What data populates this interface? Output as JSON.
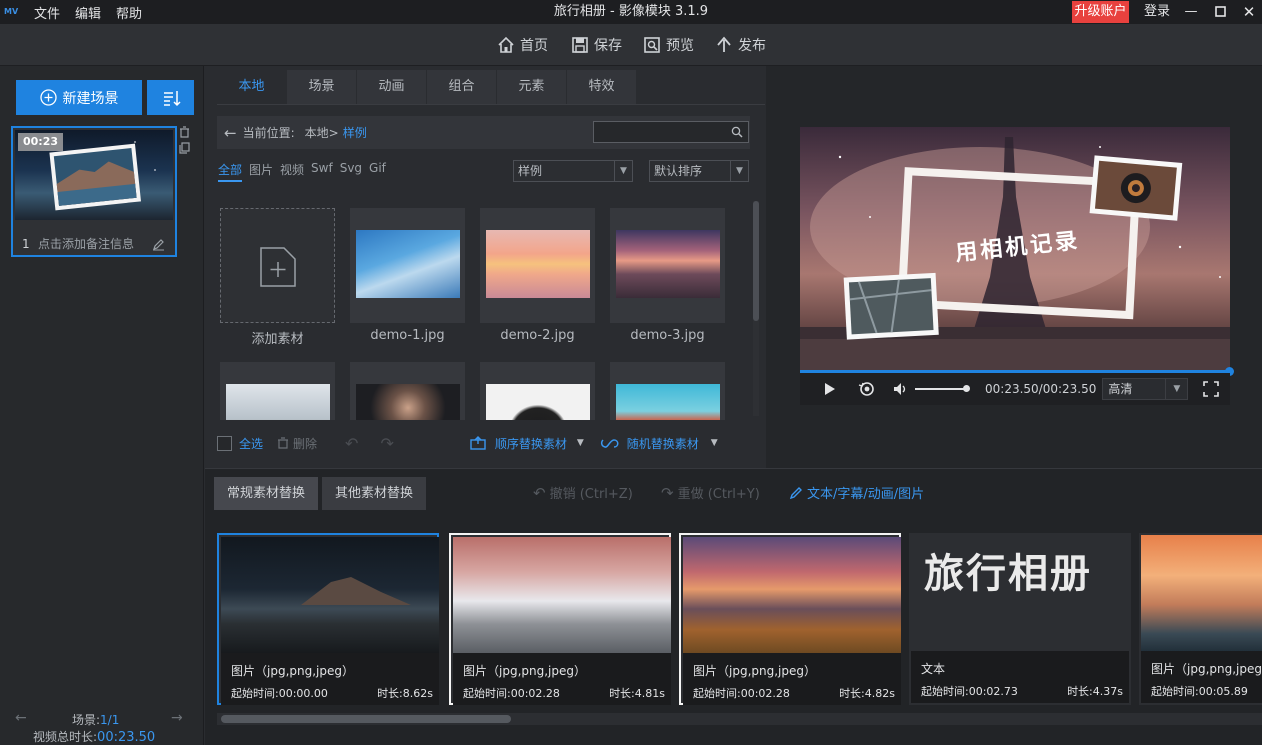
{
  "app": {
    "logo": "MV",
    "title": "旅行相册 - 影像模块 3.1.9"
  },
  "menu": [
    "文件",
    "编辑",
    "帮助"
  ],
  "account": {
    "upgrade": "升级账户",
    "login": "登录"
  },
  "toolbar": {
    "home": "首页",
    "save": "保存",
    "preview": "预览",
    "publish": "发布"
  },
  "scenes": {
    "new_scene": "新建场景",
    "cards": [
      {
        "duration": "00:23",
        "index": "1",
        "note": "点击添加备注信息"
      }
    ],
    "footer": {
      "scene_label": "场景:",
      "scene_value": "1/1",
      "total_label": "视频总时长:",
      "total_value": "00:23.50"
    }
  },
  "library": {
    "tabs": [
      "本地",
      "场景",
      "动画",
      "组合",
      "元素",
      "特效"
    ],
    "location_label": "当前位置:",
    "location_root": "本地>",
    "location_current": "样例",
    "search_placeholder": "",
    "filters": [
      "全部",
      "图片",
      "视频",
      "Swf",
      "Svg",
      "Gif"
    ],
    "folder_select": "样例",
    "sort_select": "默认排序",
    "add_label": "添加素材",
    "items": [
      "demo-1.jpg",
      "demo-2.jpg",
      "demo-3.jpg"
    ],
    "select_all": "全选",
    "delete": "删除",
    "seq_replace": "顺序替换素材",
    "rand_replace": "随机替换素材"
  },
  "player": {
    "overlay_text": "用相机记录",
    "time": "00:23.50/00:23.50",
    "quality": "高清",
    "progress": 1.0
  },
  "replace": {
    "tabs": [
      "常规素材替换",
      "其他素材替换"
    ],
    "undo": "撤销 (Ctrl+Z)",
    "redo": "重做 (Ctrl+Y)",
    "text_link": "文本/字幕/动画/图片",
    "cards": [
      {
        "type": "图片（jpg,png,jpeg）",
        "start": "起始时间:00:00.00",
        "dur": "时长:8.62s"
      },
      {
        "type": "图片（jpg,png,jpeg）",
        "start": "起始时间:00:02.28",
        "dur": "时长:4.81s"
      },
      {
        "type": "图片（jpg,png,jpeg）",
        "start": "起始时间:00:02.28",
        "dur": "时长:4.82s"
      },
      {
        "type": "文本",
        "start": "起始时间:00:02.73",
        "dur": "时长:4.37s",
        "text_preview": "旅行相册"
      },
      {
        "type": "图片（jpg,png,jpeg）",
        "start": "起始时间:00:05.89",
        "dur": ""
      }
    ]
  },
  "colors": {
    "accent": "#1f83e0",
    "upgrade": "#e8413e",
    "link": "#3a97f0"
  }
}
